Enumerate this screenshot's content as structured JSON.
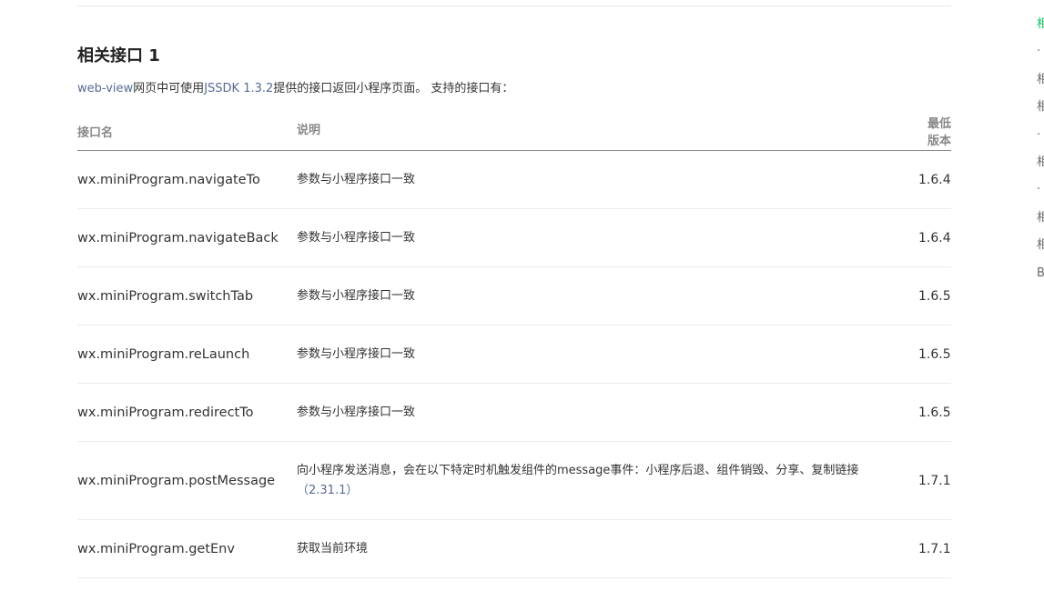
{
  "section": {
    "title": "相关接口 1",
    "intro": {
      "link_webview": "web-view",
      "text_1": "网页中可使用",
      "link_jssdk": "JSSDK 1.3.2",
      "text_2": "提供的接口返回小程序页面。 支持的接口有："
    }
  },
  "table": {
    "headers": {
      "name": "接口名",
      "desc": "说明",
      "version": "最低版本"
    },
    "rows": [
      {
        "name": "wx.miniProgram.navigateTo",
        "desc": "参数与小程序接口一致",
        "desc_version": "",
        "version": "1.6.4"
      },
      {
        "name": "wx.miniProgram.navigateBack",
        "desc": "参数与小程序接口一致",
        "desc_version": "",
        "version": "1.6.4"
      },
      {
        "name": "wx.miniProgram.switchTab",
        "desc": "参数与小程序接口一致",
        "desc_version": "",
        "version": "1.6.5"
      },
      {
        "name": "wx.miniProgram.reLaunch",
        "desc": "参数与小程序接口一致",
        "desc_version": "",
        "version": "1.6.5"
      },
      {
        "name": "wx.miniProgram.redirectTo",
        "desc": "参数与小程序接口一致",
        "desc_version": "",
        "version": "1.6.5"
      },
      {
        "name": "wx.miniProgram.postMessage",
        "desc": "向小程序发送消息，会在以下特定时机触发组件的message事件：小程序后退、组件销毁、分享、复制链接",
        "desc_version": "（2.31.1）",
        "version": "1.7.1"
      },
      {
        "name": "wx.miniProgram.getEnv",
        "desc": "获取当前环境",
        "desc_version": "",
        "version": "1.7.1"
      }
    ]
  },
  "toc": {
    "items": [
      "相",
      "·",
      "相",
      "相",
      "·",
      "相",
      "·",
      "相",
      "相",
      "B"
    ]
  },
  "colors": {
    "link": "#576b95",
    "toc_active": "#07c160",
    "text": "#333333",
    "header_text": "#888888"
  }
}
